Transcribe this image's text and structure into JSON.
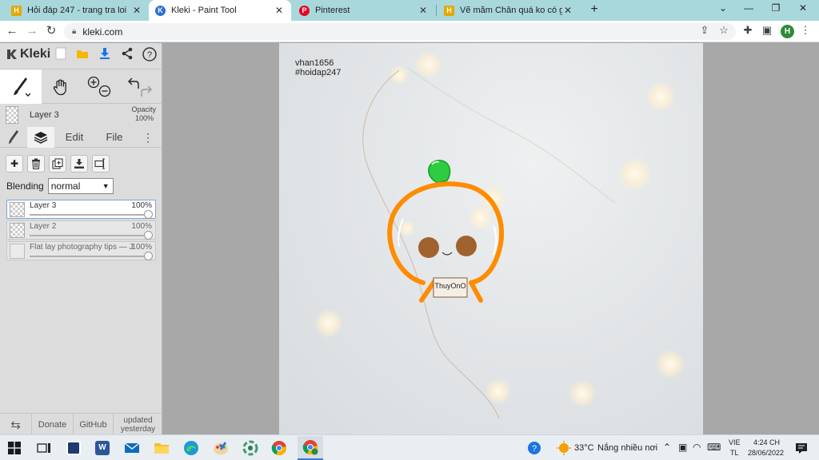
{
  "browser": {
    "tabs": [
      {
        "title": "Hỏi đáp 247 - trang tra loi",
        "favicon": "hoidap-logo-icon"
      },
      {
        "title": "Kleki - Paint Tool",
        "favicon": "kleki-logo-icon",
        "active": true
      },
      {
        "title": "Pinterest",
        "favicon": "pinterest-logo-icon"
      },
      {
        "title": "Vẽ mắm Chân quá ko có gì chơi",
        "favicon": "hoidap-logo-icon"
      }
    ],
    "new_tab_label": "+",
    "address": "kleki.com",
    "profile_initial": "H",
    "colors": {
      "tabstrip": "#a8d8dc",
      "profile": "#2e8b3a"
    }
  },
  "kleki": {
    "brand": "Kleki",
    "active_layer_name": "Layer 3",
    "opacity_label": "Opacity",
    "opacity_value": "100%",
    "panel_tabs": {
      "edit": "Edit",
      "file": "File"
    },
    "blending_label": "Blending",
    "blending_value": "normal",
    "layers": [
      {
        "name": "Layer 3",
        "opacity": "100%",
        "selected": true
      },
      {
        "name": "Layer 2",
        "opacity": "100%",
        "selected": false
      },
      {
        "name": "Flat lay photography tips — J",
        "opacity": "100%",
        "selected": false
      }
    ],
    "footer": {
      "donate": "Donate",
      "github": "GitHub",
      "updated_line1": "updated",
      "updated_line2": "yesterday"
    }
  },
  "canvas": {
    "signature_line1": "vhan1656",
    "signature_line2": "#hoidap247",
    "sign_text": "ThuyOnO",
    "colors": {
      "orange": "#ff8c00",
      "leaf": "#2ecc40",
      "cheeks": "#a0622d"
    }
  },
  "taskbar": {
    "weather_temp": "33°C",
    "weather_text": "Nắng nhiều nơi",
    "lang_line1": "VIE",
    "lang_line2": "TL",
    "time": "4:24 CH",
    "date": "28/06/2022"
  }
}
